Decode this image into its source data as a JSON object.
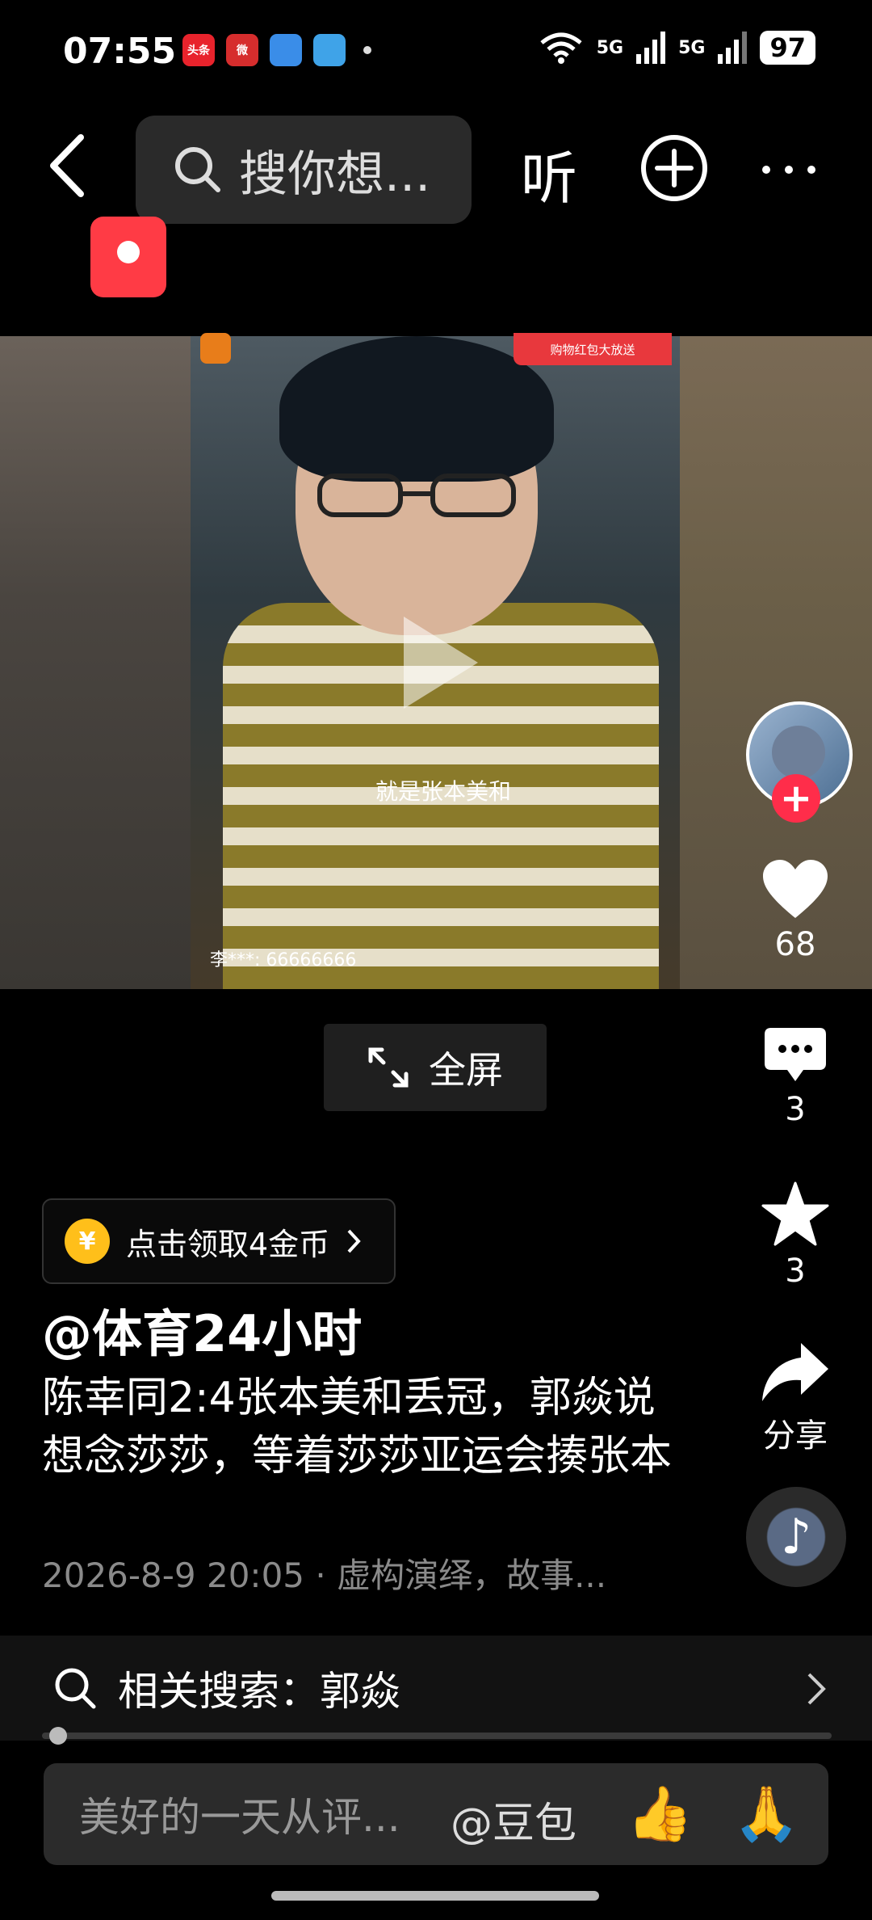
{
  "status_bar": {
    "time": "07:55",
    "network_1": "5G",
    "network_2": "5G",
    "battery": "97",
    "app_badges": [
      "头条",
      "微",
      "",
      ""
    ]
  },
  "top_bar": {
    "search_placeholder": "搜你想...",
    "listen_label": "听"
  },
  "video": {
    "subtitle": "就是张本美和",
    "banner_text": "购物红包大放送",
    "chat_line": "李***: 66666666",
    "fullscreen_label": "全屏"
  },
  "actions": {
    "like_count": "68",
    "comment_count": "3",
    "favorite_count": "3",
    "share_label": "分享"
  },
  "info": {
    "coin_label": "点击领取4金币",
    "coin_symbol": "¥",
    "author": "@体育24小时",
    "description": "陈幸同2:4张本美和丢冠，郭焱说想念莎莎，等着莎莎亚运会揍张本",
    "meta": "2026-8-9 20:05 · 虚构演绎，故事..."
  },
  "related_search": {
    "label": "相关搜索：郭焱"
  },
  "comment_bar": {
    "placeholder": "美好的一天从评...",
    "mention": "@豆包",
    "emoji_1": "👍",
    "emoji_2": "🙏"
  },
  "progress": {
    "fraction": 0.02
  }
}
